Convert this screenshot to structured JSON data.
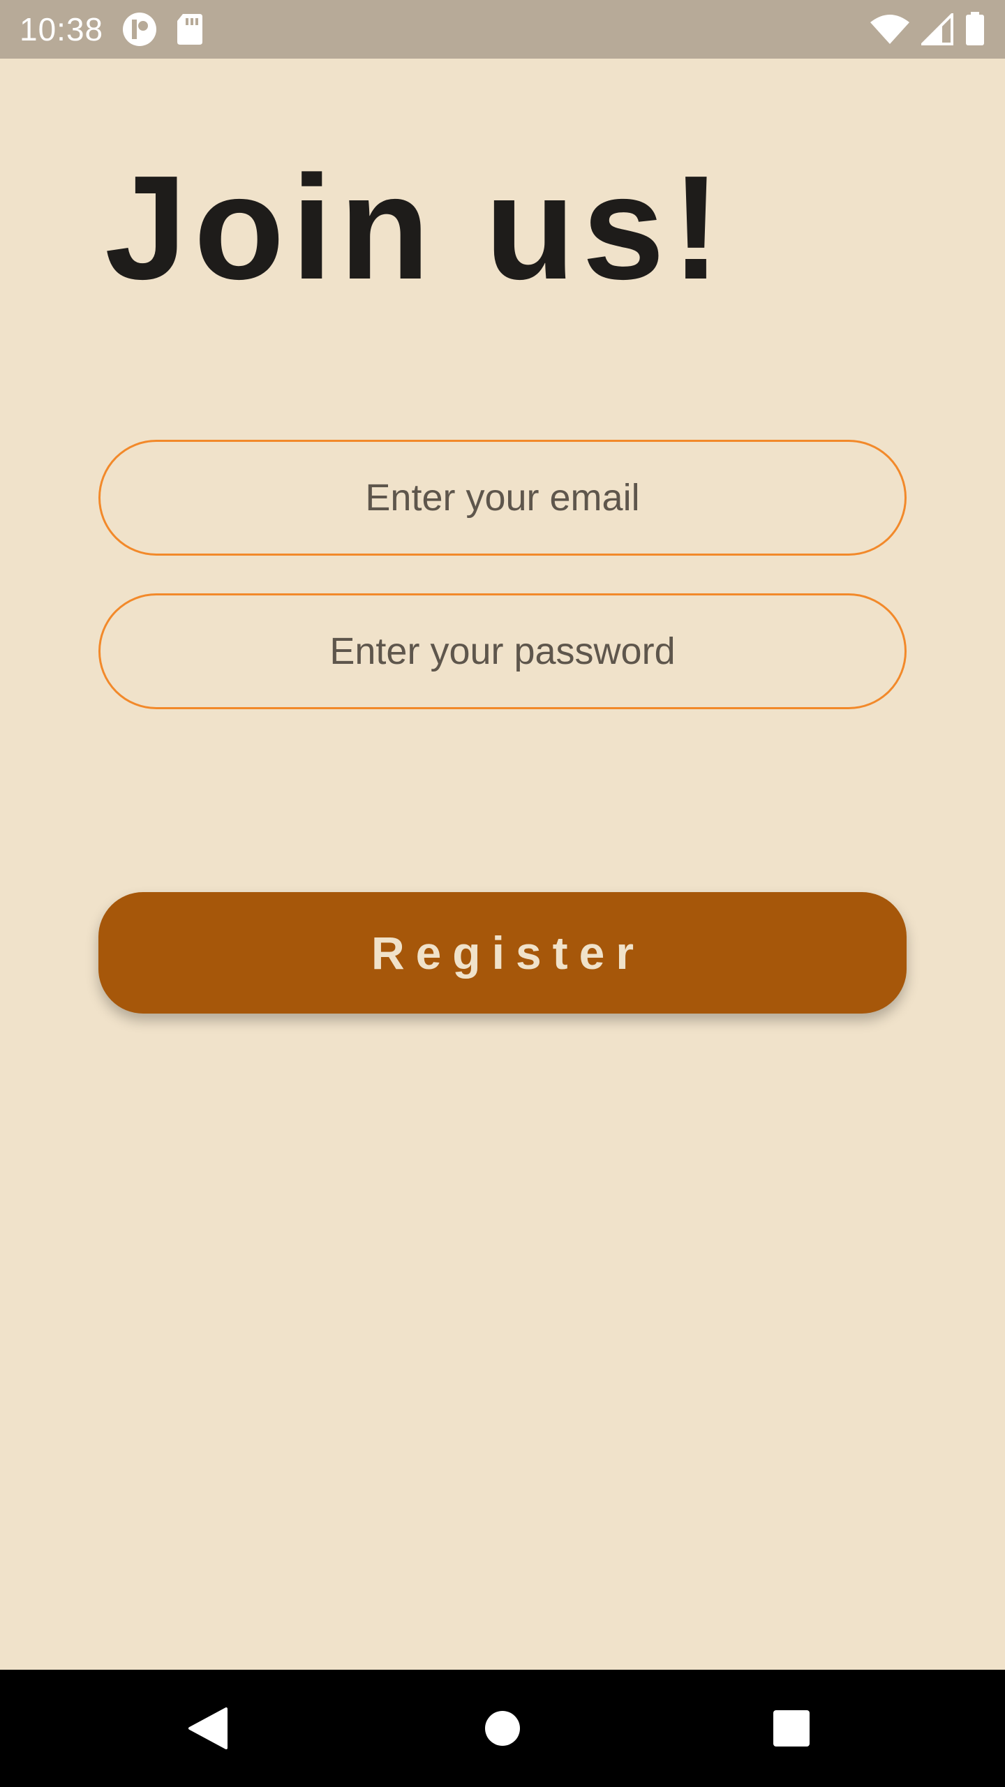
{
  "status_bar": {
    "time": "10:38",
    "icons": [
      "media-app-icon",
      "sd-card-icon",
      "wifi-icon",
      "cell-signal-icon",
      "battery-icon"
    ]
  },
  "main": {
    "title": "Join us!",
    "email_placeholder": "Enter your email",
    "password_placeholder": "Enter your password",
    "register_label": "Register"
  },
  "nav_bar": {
    "buttons": [
      "back-icon",
      "home-icon",
      "recents-icon"
    ]
  },
  "colors": {
    "background": "#F0E2CA",
    "status_bar": "#B7AA98",
    "field_border": "#F2892A",
    "button": "#A6570A",
    "button_text": "#F0E2CA",
    "title": "#1E1C1A",
    "placeholder": "#5E564C",
    "nav_bar": "#000000"
  }
}
